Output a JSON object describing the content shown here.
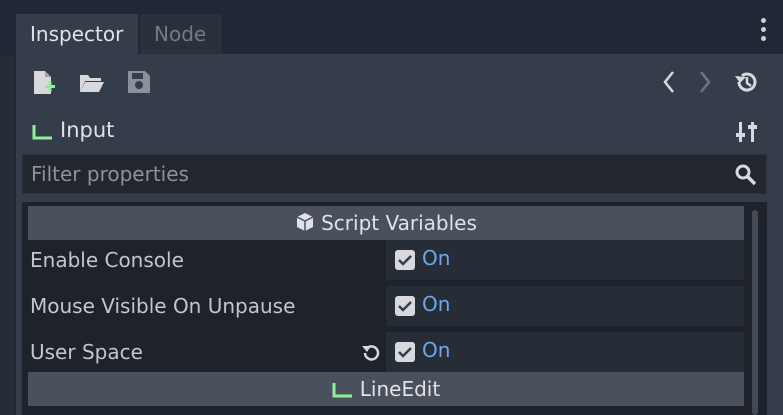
{
  "tabs": {
    "inspector": "Inspector",
    "node": "Node"
  },
  "toolbar": {
    "icons": [
      "new-resource-icon",
      "open-folder-icon",
      "save-icon",
      "history-back-icon",
      "history-forward-icon",
      "object-history-icon"
    ]
  },
  "object": {
    "name": "Input"
  },
  "filter": {
    "placeholder": "Filter properties"
  },
  "sections": [
    {
      "title": "Script Variables"
    },
    {
      "title": "LineEdit"
    }
  ],
  "properties": [
    {
      "label": "Enable Console",
      "value": "On"
    },
    {
      "label": "Mouse Visible On Unpause",
      "value": "On"
    },
    {
      "label": "User Space",
      "value": "On"
    }
  ],
  "colors": {
    "accent": "#6fa5ea",
    "node_green": "#8eef97",
    "panel": "#363d4a",
    "background": "#212835"
  }
}
